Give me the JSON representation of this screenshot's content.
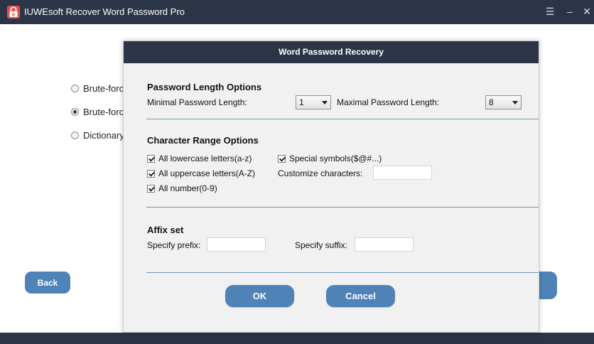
{
  "app": {
    "title": "IUWEsoft Recover Word Password Pro",
    "icon": "lock-app-icon",
    "window_controls": [
      "menu-icon",
      "minimize-icon",
      "close-icon"
    ]
  },
  "main": {
    "attack_options": [
      {
        "label": "Brute-force",
        "selected": false
      },
      {
        "label": "Brute-force",
        "selected": true
      },
      {
        "label": "Dictionary",
        "selected": false
      }
    ],
    "back_label": "Back"
  },
  "dialog": {
    "title": "Word Password Recovery",
    "length": {
      "title": "Password Length Options",
      "min_label": "Minimal Password Length:",
      "min_value": "1",
      "max_label": "Maximal Password Length:",
      "max_value": "8"
    },
    "charset": {
      "title": "Character Range Options",
      "lowercase": {
        "label": "All lowercase letters(a-z)",
        "checked": true
      },
      "uppercase": {
        "label": "All uppercase letters(A-Z)",
        "checked": true
      },
      "number": {
        "label": "All number(0-9)",
        "checked": true
      },
      "special": {
        "label": "Special symbols($@#...)",
        "checked": true
      },
      "customize_label": "Customize characters:",
      "customize_value": ""
    },
    "affix": {
      "title": "Affix set",
      "prefix_label": "Specify prefix:",
      "prefix_value": "",
      "suffix_label": "Specify suffix:",
      "suffix_value": ""
    },
    "ok_label": "OK",
    "cancel_label": "Cancel"
  },
  "colors": {
    "titlebar": "#2b3547",
    "button": "#4f83b8",
    "divider": "#6d98b9",
    "dialog_bg": "#f1f1f1"
  }
}
